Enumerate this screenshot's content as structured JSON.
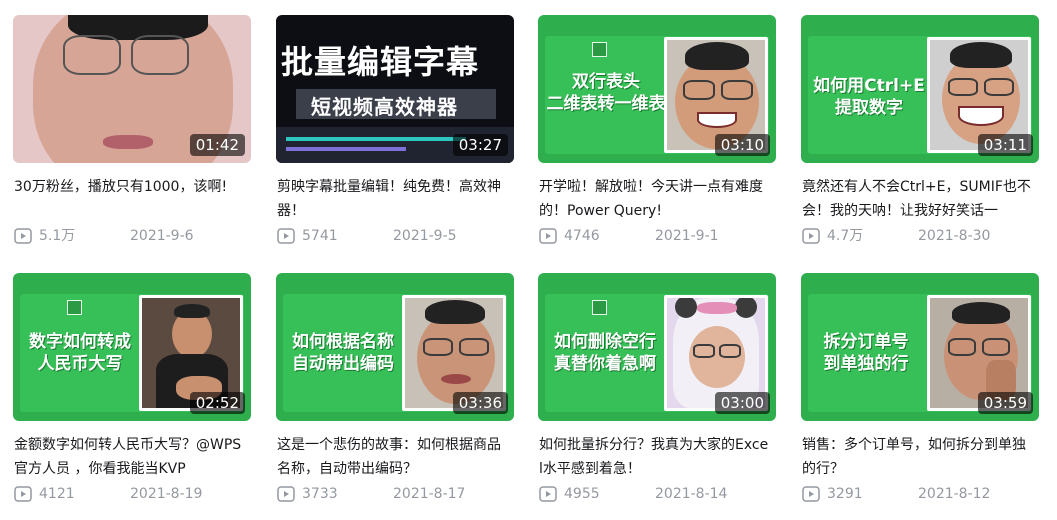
{
  "videos": [
    {
      "duration": "01:42",
      "title": "30万粉丝，播放只有1000，该啊!",
      "views": "5.1万",
      "date": "2021-9-6"
    },
    {
      "duration": "03:27",
      "title": "剪映字幕批量编辑！纯免费！高效神器！",
      "views": "5741",
      "date": "2021-9-5",
      "thumb_text": [
        "批量编辑字幕",
        "短视频高效神器"
      ]
    },
    {
      "duration": "03:10",
      "title": "开学啦！解放啦！今天讲一点有难度的！Power Query!",
      "views": "4746",
      "date": "2021-9-1",
      "thumb_text": [
        "双行表头",
        "二维表转一维表"
      ]
    },
    {
      "duration": "03:11",
      "title": "竟然还有人不会Ctrl+E，SUMIF也不会！我的天呐！让我好好笑话一",
      "views": "4.7万",
      "date": "2021-8-30",
      "thumb_text": [
        "如何用Ctrl+E",
        "提取数字"
      ]
    },
    {
      "duration": "02:52",
      "title": "金额数字如何转人民币大写？@WPS官方人员 ，你看我能当KVP",
      "views": "4121",
      "date": "2021-8-19",
      "thumb_text": [
        "数字如何转成",
        "人民币大写"
      ]
    },
    {
      "duration": "03:36",
      "title": "这是一个悲伤的故事：如何根据商品名称，自动带出编码？",
      "views": "3733",
      "date": "2021-8-17",
      "thumb_text": [
        "如何根据名称",
        "自动带出编码"
      ]
    },
    {
      "duration": "03:00",
      "title": "如何批量拆分行？我真为大家的Excel水平感到着急！",
      "views": "4955",
      "date": "2021-8-14",
      "thumb_text": [
        "如何删除空行",
        "真替你着急啊"
      ]
    },
    {
      "duration": "03:59",
      "title": "销售：多个订单号，如何拆分到单独的行？",
      "views": "3291",
      "date": "2021-8-12",
      "thumb_text": [
        "拆分订单号",
        "到单独的行"
      ]
    }
  ],
  "icons": {
    "views": "play-count-icon"
  },
  "colors": {
    "accent_green": "#2fae4d",
    "meta_gray": "#9499a0",
    "title_text": "#18191c"
  }
}
